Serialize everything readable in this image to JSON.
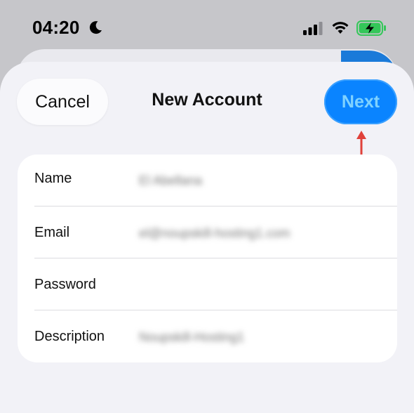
{
  "status_bar": {
    "time": "04:20",
    "icons": [
      "moon-icon",
      "signal-icon",
      "wifi-icon",
      "battery-charging-icon"
    ],
    "battery_color": "#34c759"
  },
  "header": {
    "cancel_label": "Cancel",
    "title": "New Account",
    "next_label": "Next",
    "accent_color": "#0a84ff"
  },
  "form": {
    "rows": [
      {
        "label": "Name",
        "value": "El Abellana"
      },
      {
        "label": "Email",
        "value": "el@noupskill-hosting1.com"
      },
      {
        "label": "Password",
        "value": ""
      },
      {
        "label": "Description",
        "value": "Noupskill-Hosting1"
      }
    ]
  },
  "annotation": {
    "arrow_color": "#e0413a"
  }
}
